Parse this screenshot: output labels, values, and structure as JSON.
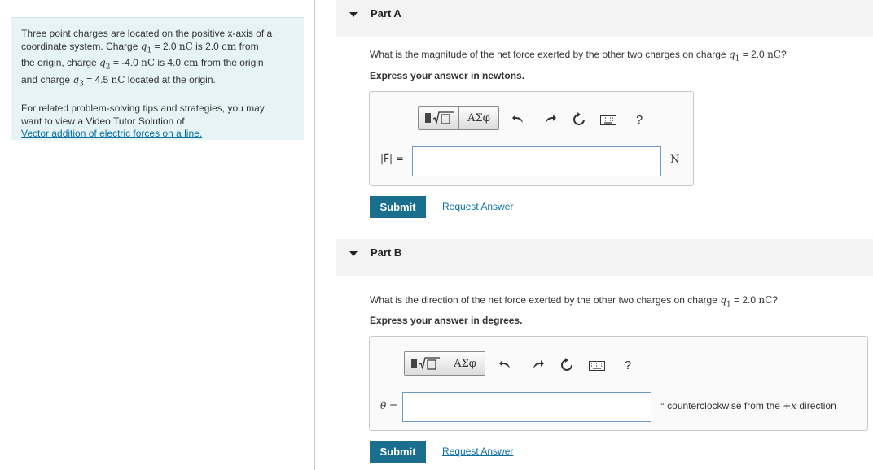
{
  "problem": {
    "intro_1": "Three point charges are located on the positive x-axis of a",
    "intro_2a": "coordinate system. Charge ",
    "q1_sym": "q",
    "q1_sub": "1",
    "intro_2b": " = 2.0 ",
    "unit_nC": "nC",
    "intro_2c": " is 2.0 ",
    "unit_cm": "cm",
    "intro_2d": " from",
    "intro_3a": "the origin,  charge ",
    "q2_sym": "q",
    "q2_sub": "2",
    "intro_3b": " = -4.0 ",
    "intro_3c": " is 4.0 ",
    "intro_3d": " from the origin",
    "intro_4a": "and charge ",
    "q3_sym": "q",
    "q3_sub": "3",
    "intro_4b": " = 4.5 ",
    "intro_4c": " located at the origin.",
    "tips_1": "For related problem-solving tips and strategies, you may",
    "tips_2": "want to view a Video Tutor Solution of",
    "tips_link": "Vector addition of electric forces on a line."
  },
  "toolbar": {
    "template_icon": "template-icon",
    "greek_label": "ΑΣφ",
    "undo_icon": "undo-icon",
    "redo_icon": "redo-icon",
    "reset_icon": "reset-icon",
    "keyboard_icon": "keyboard-icon",
    "help_label": "?"
  },
  "partA": {
    "title": "Part A",
    "question_a": "What is the magnitude of the net force exerted by the other two charges on charge ",
    "q_sym": "q",
    "q_sub": "1",
    "question_b": " = 2.0 ",
    "question_unit": "nC",
    "question_c": "?",
    "instruction": "Express your answer in newtons.",
    "var_label": "|F⃗| =",
    "input_value": "",
    "unit": "N",
    "submit_label": "Submit",
    "request_label": "Request Answer"
  },
  "partB": {
    "title": "Part B",
    "question_a": "What is the direction of the net force exerted by the other two charges on charge ",
    "q_sym": "q",
    "q_sub": "1",
    "question_b": " = 2.0 ",
    "question_unit": "nC",
    "question_c": "?",
    "instruction": "Express your answer in degrees.",
    "var_label": "θ =",
    "input_value": "",
    "unit_deg": "°",
    "unit_a": " counterclockwise from the ",
    "unit_plus": "+",
    "unit_x": "x",
    "unit_b": " direction",
    "submit_label": "Submit",
    "request_label": "Request Answer"
  },
  "colors": {
    "panel_bg": "#e6f4f5",
    "link": "#0b6fa3",
    "submit_bg": "#1a6f8e",
    "input_border": "#6a9bc5"
  }
}
